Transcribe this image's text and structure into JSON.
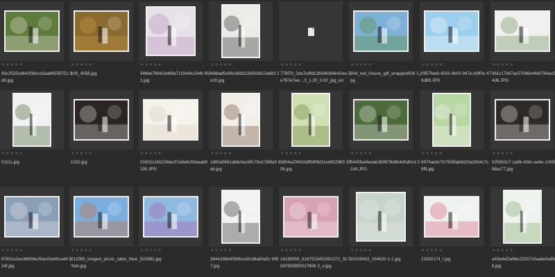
{
  "browser": {
    "rating_stars": "★★★★★",
    "items": [
      {
        "row": 0,
        "col": 0,
        "filename": "90c2525cd642f38ccd3aa86359751 0d8.jpg",
        "orientation": "landscape",
        "bg": "#5d7b3b",
        "accent": "#e8e1d4",
        "icon": "garden-table-photo"
      },
      {
        "row": 0,
        "col": 1,
        "filename": "100_4058.jpg",
        "orientation": "landscape",
        "bg": "#8a6a2e",
        "accent": "#c59a48",
        "icon": "autumn-park-photo"
      },
      {
        "row": 0,
        "col": 2,
        "filename": "346be76941bd69a71f1b48c234b f931.jpg",
        "orientation": "square",
        "bg": "#e7e0e8",
        "accent": "#b78cb8",
        "icon": "bride-flowers-photo"
      },
      {
        "row": 0,
        "col": 3,
        "filename": "468baf5e06c38d322b593812a683 2e20.jpg",
        "orientation": "portrait",
        "bg": "#e9ece7",
        "accent": "#2a2a2a",
        "icon": "couple-green-arch-photo"
      },
      {
        "row": 0,
        "col": 4,
        "filename": "778f70_2da7e8fd138346369c42ee 5e767e7ee....0_1.20_0.00_jpg_wz",
        "orientation": "placeholder",
        "bg": "#2f2f2f",
        "accent": "#e9e9e9",
        "icon": "missing-file-icon"
      },
      {
        "row": 0,
        "col": 5,
        "filename": "804_red_House_gift_wrapped000 1.jpg",
        "orientation": "landscape",
        "bg": "#7fb0d8",
        "accent": "#5d8c2f",
        "icon": "house-lawn-photo"
      },
      {
        "row": 0,
        "col": 6,
        "filename": "0957fee6-4332-4b02-947e-b3ff0e 476d88.JPG",
        "orientation": "landscape",
        "bg": "#9ccfee",
        "accent": "#f6f6f6",
        "icon": "couple-sky-photo"
      },
      {
        "row": 0,
        "col": 7,
        "filename": "961c17467ac57088e4682784ac51 14d6.JPG",
        "orientation": "landscape",
        "bg": "#f0f0f0",
        "accent": "#6c8c54",
        "icon": "couple-white-arch-photo"
      },
      {
        "row": 1,
        "col": 0,
        "filename": "01111.jpg",
        "orientation": "portrait",
        "bg": "#f1f1f1",
        "accent": "#3d5b2a",
        "icon": "bride-window-photo"
      },
      {
        "row": 1,
        "col": 1,
        "filename": "1532.jpg",
        "orientation": "landscape",
        "bg": "#2c2523",
        "accent": "#d8d8d8",
        "icon": "couple-doorway-photo"
      },
      {
        "row": 1,
        "col": 2,
        "filename": "01602c1b523fdac57a9e8c59aaa89 290.JPG",
        "orientation": "landscape",
        "bg": "#f6f2ec",
        "accent": "#d8cdbf",
        "icon": "white-room-photo"
      },
      {
        "row": 1,
        "col": 3,
        "filename": "1880a5661a66c6a16f170a1766fe5 8ab.jpg",
        "orientation": "portrait",
        "bg": "#f2efe9",
        "accent": "#6e4b34",
        "icon": "couple-steps-photo"
      },
      {
        "row": 1,
        "col": 4,
        "filename": "3854a206419df08f9d31ed922983 280b.jpg",
        "orientation": "portrait",
        "bg": "#cfe1b3",
        "accent": "#6b7e3a",
        "icon": "forest-bench-photo"
      },
      {
        "row": 1,
        "col": 5,
        "filename": "5440fed4edab389978d8b4d5d61d 32d4.JPG",
        "orientation": "landscape",
        "bg": "#4c6b3a",
        "accent": "#e6e6e6",
        "icon": "couple-garden-photo"
      },
      {
        "row": 1,
        "col": 6,
        "filename": "6974ae9c7b7556fab8d33a2934c7c 9f9.jpg",
        "orientation": "portrait",
        "bg": "#b8d7a3",
        "accent": "#f3f3f3",
        "icon": "greenhouse-photo"
      },
      {
        "row": 1,
        "col": 7,
        "filename": "025653c7-1a9b-426c-ae6e-12655d 68ac77.jpg",
        "orientation": "landscape",
        "bg": "#2f2a26",
        "accent": "#e3e3e3",
        "icon": "floral-staircase-photo"
      },
      {
        "row": 2,
        "col": 0,
        "filename": "87851e3ee38b56e29ac43a60ca44 924f.jpg",
        "orientation": "landscape",
        "bg": "#8aa0b8",
        "accent": "#e9dfe9",
        "icon": "couple-blossom-photo"
      },
      {
        "row": 2,
        "col": 1,
        "filename": "212565_longest_picnic_table_New _York.jpg",
        "orientation": "landscape",
        "bg": "#79aee0",
        "accent": "#d96b2a",
        "icon": "harbor-picnic-photo"
      },
      {
        "row": 2,
        "col": 2,
        "filename": "922962.jpg",
        "orientation": "landscape",
        "bg": "#8eb9e0",
        "accent": "#b25aa8",
        "icon": "flower-arch-photo"
      },
      {
        "row": 2,
        "col": 3,
        "filename": "364418bb4f388cce91d6ab9a5c 9957.jpg",
        "orientation": "portrait",
        "bg": "#f2f2f2",
        "accent": "#2a2a2a",
        "icon": "couple-ivy-arch-photo"
      },
      {
        "row": 2,
        "col": 4,
        "filename": "14188356_6167515451591372_32 5047693950017806 3_o.jpg",
        "orientation": "landscape",
        "bg": "#d7a1b6",
        "accent": "#f3e9ee",
        "icon": "pink-couple-photo"
      },
      {
        "row": 2,
        "col": 5,
        "filename": "20150402_194820-1-1.jpg",
        "orientation": "square",
        "bg": "#c6d3c9",
        "accent": "#e9e9e9",
        "icon": "canopy-bed-photo"
      },
      {
        "row": 2,
        "col": 6,
        "filename": "21920174_l.jpg",
        "orientation": "landscape",
        "bg": "#eef2ee",
        "accent": "#d95a7b",
        "icon": "white-pavilion-photo"
      },
      {
        "row": 2,
        "col": 7,
        "filename": "a43e4ef2a9be22937c0aa6e5a9fe 446.jpg",
        "orientation": "portrait",
        "bg": "#eef3ee",
        "accent": "#7aa660",
        "icon": "arched-windows-photo"
      }
    ]
  }
}
